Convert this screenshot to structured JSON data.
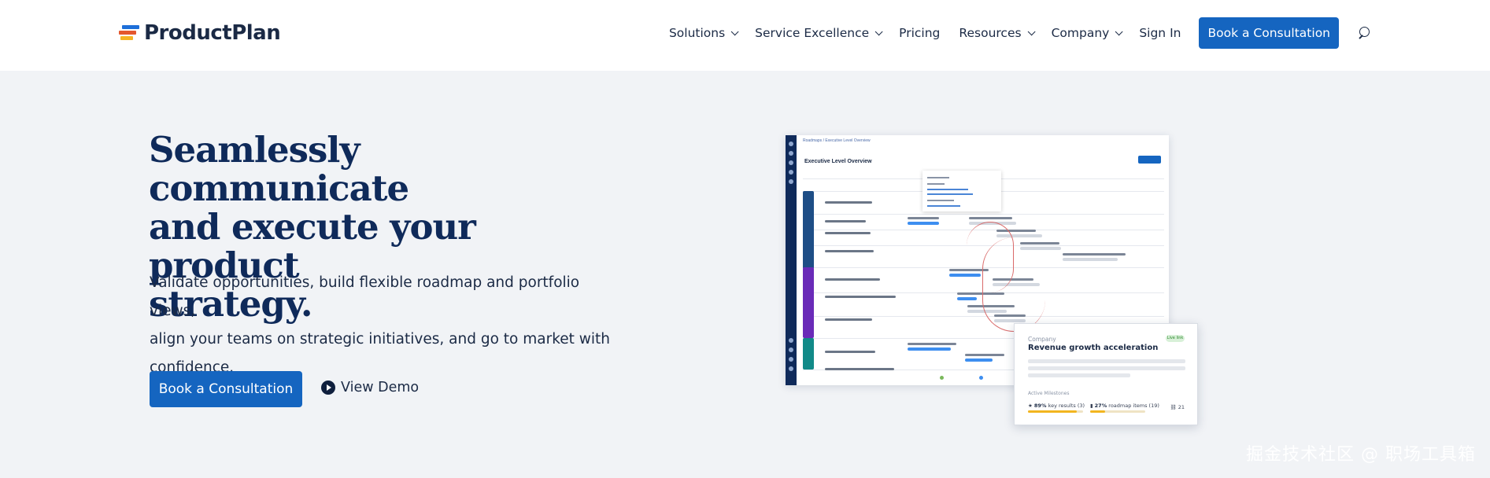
{
  "header": {
    "brand": "ProductPlan",
    "nav": [
      {
        "label": "Solutions",
        "has_dropdown": true
      },
      {
        "label": "Service Excellence",
        "has_dropdown": true
      },
      {
        "label": "Pricing",
        "has_dropdown": false
      },
      {
        "label": "Resources",
        "has_dropdown": true
      },
      {
        "label": "Company",
        "has_dropdown": true
      },
      {
        "label": "Sign In",
        "has_dropdown": false
      }
    ],
    "cta_label": "Book a Consultation",
    "search_icon": "search-icon"
  },
  "hero": {
    "title_lines": [
      "Seamlessly communicate",
      "and execute your product",
      "strategy."
    ],
    "body_lines": [
      "Validate opportunities, build flexible roadmap and portfolio views,",
      "align your teams on strategic initiatives, and go to market with",
      "confidence."
    ],
    "cta_label": "Book a Consultation",
    "demo_label": "View Demo",
    "demo_icon": "play-circle-icon"
  },
  "mock": {
    "breadcrumb": "Roadmaps / Executive Level Overview",
    "title": "Executive Level Overview"
  },
  "card": {
    "kicker": "Company",
    "title": "Revenue growth acceleration",
    "badge": "Live link",
    "section": "Active Milestones",
    "metric_1_value": "89%",
    "metric_1_label": "key results (3)",
    "metric_1_progress": 0.89,
    "metric_2_value": "27%",
    "metric_2_label": "roadmap items (19)",
    "metric_2_progress": 0.27,
    "count": "21"
  },
  "watermark": "掘金技术社区 @ 职场工具箱",
  "colors": {
    "brand_blue": "#1565c0",
    "headline": "#0f2a5a",
    "page_bg": "#f1f3f6"
  }
}
